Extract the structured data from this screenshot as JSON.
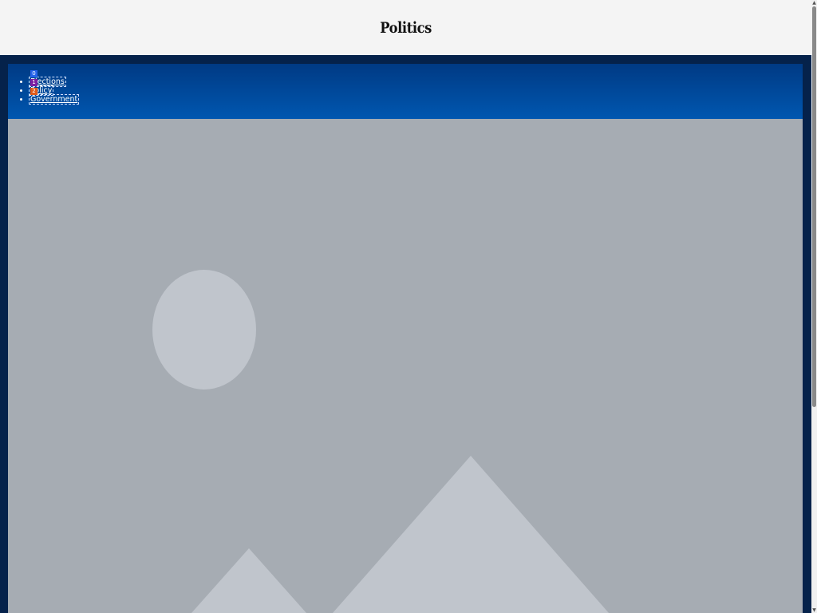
{
  "header": {
    "title": "Politics"
  },
  "nav": {
    "items": [
      {
        "label": "Elections"
      },
      {
        "label": "Policy"
      },
      {
        "label": "Government"
      }
    ]
  },
  "overlay_badges": [
    "0",
    "1",
    "2"
  ],
  "hero": {
    "icon": "image-placeholder-icon"
  },
  "scrollbar": {
    "up_glyph": "▲",
    "down_glyph": "▼"
  },
  "colors": {
    "header_bg": "#f4f4f4",
    "page_bg": "#05224b",
    "nav_top": "#003a84",
    "nav_bottom": "#0057b0",
    "placeholder_bg": "#a6acb3",
    "placeholder_shape": "#c0c5cc"
  }
}
